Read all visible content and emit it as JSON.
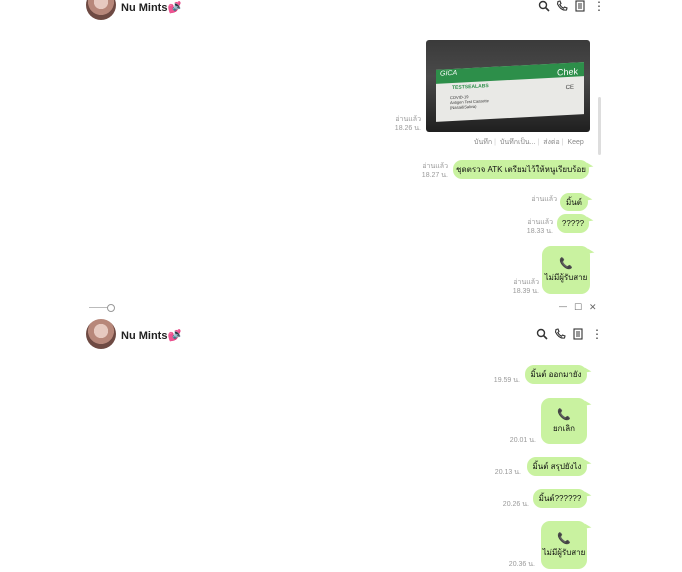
{
  "panel1": {
    "contact_name": "Nu Mints💕",
    "image_acts": [
      "บันทึก",
      "บันทึกเป็น...",
      "ส่งต่อ",
      "Keep"
    ],
    "image_text": {
      "brand": "GICA",
      "product": "Chek",
      "maker": "TESTSEALABS",
      "line1": "COVID-19",
      "line2": "Antigen Test Cassette",
      "line3": "(Nasal&Saliva)",
      "ce": "CE"
    },
    "messages": [
      {
        "read": "อ่านแล้ว",
        "time": "18.26 น."
      },
      {
        "read": "อ่านแล้ว",
        "time": "18.27 น.",
        "text": "ชุดตรวจ ATK เตรียมไว้ให้หนูเรียบร้อย"
      },
      {
        "read": "อ่านแล้ว",
        "time": "",
        "text": "มิ้นต์"
      },
      {
        "read": "อ่านแล้ว",
        "time": "18.33 น.",
        "text": "?????"
      },
      {
        "read": "อ่านแล้ว",
        "time": "18.39 น.",
        "text": "ไม่มีผู้รับสาย"
      }
    ]
  },
  "panel2": {
    "contact_name": "Nu Mints💕",
    "messages": [
      {
        "time": "19.59 น.",
        "text": "มิ้นต์ ออกมายัง"
      },
      {
        "time": "20.01 น.",
        "text": "ยกเลิก"
      },
      {
        "time": "20.13 น.",
        "text": "มิ้นต์ สรุปยังไง"
      },
      {
        "time": "20.26 น.",
        "text": "มิ้นต์??????"
      },
      {
        "time": "20.36 น.",
        "text": "ไม่มีผู้รับสาย"
      }
    ]
  },
  "window_controls": {
    "minimize": "—",
    "maximize": "☐",
    "close": "✕"
  },
  "icons": {
    "speaker": "🔈",
    "phone": "📞",
    "search": "search-icon",
    "call": "phone-icon",
    "notes": "notes-icon",
    "more": "⋮"
  }
}
